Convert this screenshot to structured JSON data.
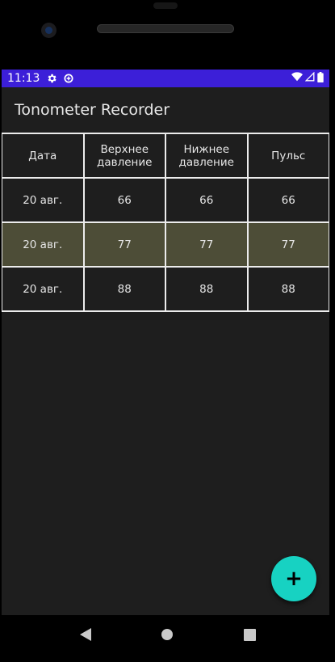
{
  "status_bar": {
    "time": "11:13",
    "icons": [
      "gear-icon",
      "data-saver-icon",
      "wifi-icon",
      "cell-signal-icon",
      "battery-icon"
    ],
    "background": "#3c1fd8"
  },
  "app_bar": {
    "title": "Tonometer Recorder"
  },
  "table": {
    "headers": [
      {
        "line1": "Дата",
        "line2": ""
      },
      {
        "line1": "Верхнее",
        "line2": "давление"
      },
      {
        "line1": "Нижнее",
        "line2": "давление"
      },
      {
        "line1": "Пульс",
        "line2": ""
      }
    ],
    "rows": [
      {
        "date": "20 авг.",
        "systolic": "66",
        "diastolic": "66",
        "pulse": "66",
        "selected": false
      },
      {
        "date": "20 авг.",
        "systolic": "77",
        "diastolic": "77",
        "pulse": "77",
        "selected": true
      },
      {
        "date": "20 авг.",
        "systolic": "88",
        "diastolic": "88",
        "pulse": "88",
        "selected": false
      }
    ],
    "selected_row_color": "#4d4d37"
  },
  "fab": {
    "label": "+",
    "icon": "plus-icon",
    "color": "#17d2c2"
  },
  "nav_bar": {
    "icons": [
      "back-icon",
      "home-icon",
      "recents-icon"
    ]
  }
}
